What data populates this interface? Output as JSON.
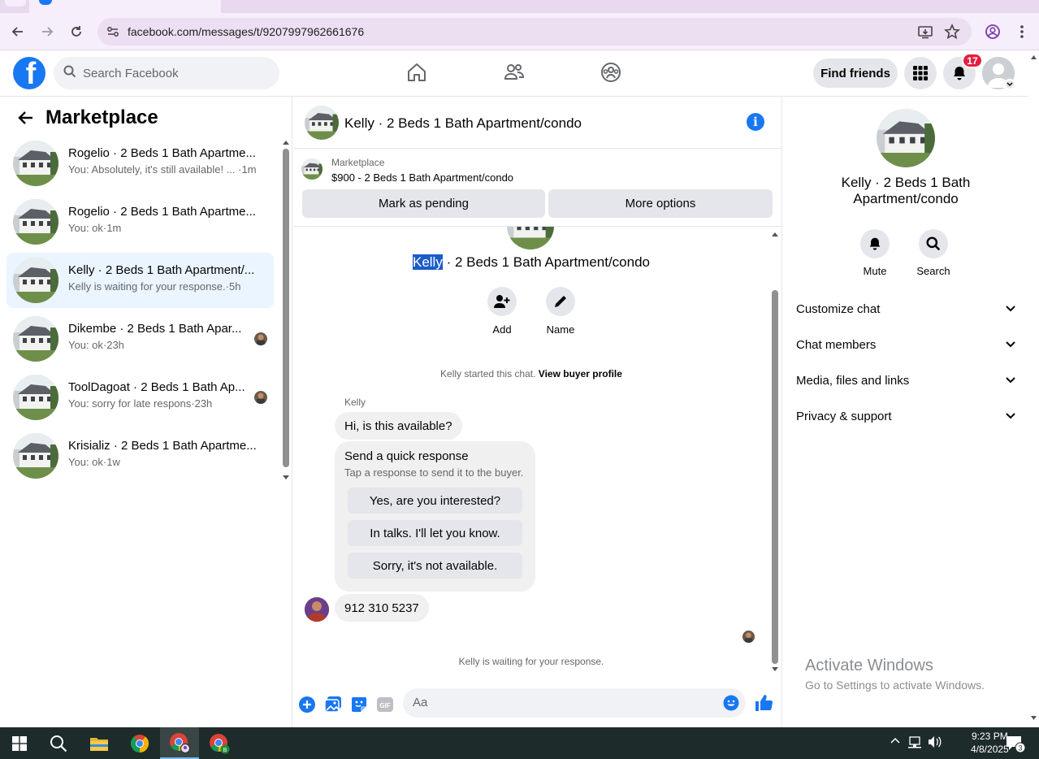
{
  "browser": {
    "url": "facebook.com/messages/t/9207997962661676",
    "icons": [
      "back-arrow-icon",
      "forward-arrow-icon",
      "reload-icon",
      "site-info-icon",
      "install-app-icon",
      "bookmark-star-icon",
      "profile-icon",
      "kebab-menu-icon"
    ]
  },
  "topbar": {
    "logo_letter": "f",
    "search_placeholder": "Search Facebook",
    "find_friends_label": "Find friends",
    "notification_count": "17",
    "accent_color": "#1877f2"
  },
  "left_panel": {
    "title": "Marketplace",
    "conversations": [
      {
        "title": "Rogelio · 2 Beds 1 Bath Apartme...",
        "subtitle": "You: Absolutely, it's still available! ... ·1m",
        "active": false
      },
      {
        "title": "Rogelio · 2 Beds 1 Bath Apartme...",
        "subtitle": "You: ok·1m",
        "active": false
      },
      {
        "title": "Kelly · 2 Beds 1 Bath Apartment/...",
        "subtitle": "Kelly is waiting for your response.·5h",
        "active": true
      },
      {
        "title": "Dikembe · 2 Beds 1 Bath Apar...",
        "subtitle": "You: ok·23h",
        "active": false
      },
      {
        "title": "ToolDagoat · 2 Beds 1 Bath Ap...",
        "subtitle": "You: sorry for late respons·23h",
        "active": false
      },
      {
        "title": "Krisializ · 2 Beds 1 Bath Apartme...",
        "subtitle": "You: ok·1w",
        "active": false
      }
    ]
  },
  "chat": {
    "header_name": "Kelly · 2 Beds 1 Bath Apartment/condo",
    "listing_label": "Marketplace",
    "listing_price": "$900 - 2 Beds 1 Bath Apartment/condo",
    "mark_pending_label": "Mark as pending",
    "more_options_label": "More options",
    "title_highlight": "Kelly",
    "title_rest": " · 2 Beds 1 Bath Apartment/condo",
    "add_label": "Add",
    "name_label": "Name",
    "started_text": "Kelly started this chat. ",
    "view_profile_label": "View buyer profile",
    "sender_name": "Kelly",
    "first_message": "Hi, is this available?",
    "quick_response_title": "Send a quick response",
    "quick_response_sub": "Tap a response to send it to the buyer.",
    "quick_responses": [
      "Yes, are you interested?",
      "In talks. I'll let you know.",
      "Sorry, it's not available."
    ],
    "reply_message": "912 310 5237",
    "waiting_text": "Kelly is waiting for your response.",
    "composer_placeholder": "Aa"
  },
  "right_panel": {
    "name": "Kelly · 2 Beds 1 Bath Apartment/condo",
    "mute_label": "Mute",
    "search_label": "Search",
    "sections": [
      "Customize chat",
      "Chat members",
      "Media, files and links",
      "Privacy & support"
    ]
  },
  "watermark": {
    "line1": "Activate Windows",
    "line2": "Go to Settings to activate Windows."
  },
  "taskbar": {
    "time": "9:23 PM",
    "date": "4/8/2025",
    "notification_count": "3"
  }
}
